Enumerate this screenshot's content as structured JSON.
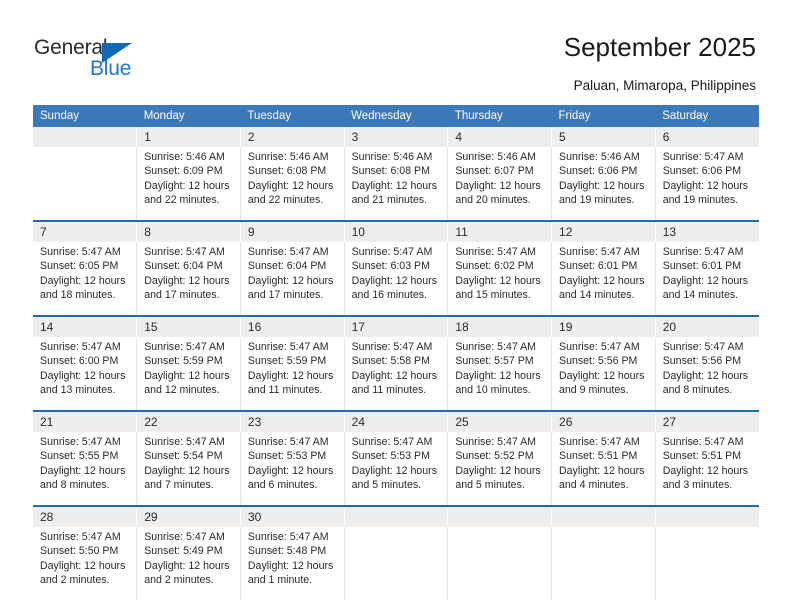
{
  "brand": {
    "name_top": "General",
    "name_bottom": "Blue",
    "color_primary": "#1269b0",
    "color_text": "#2b2b2b"
  },
  "header": {
    "title": "September 2025",
    "subtitle": "Paluan, Mimaropa, Philippines",
    "header_bg": "#3b79b8",
    "daynum_bg": "#eeeeee",
    "rule_color": "#1f6cb0"
  },
  "calendar": {
    "weekdays": [
      "Sunday",
      "Monday",
      "Tuesday",
      "Wednesday",
      "Thursday",
      "Friday",
      "Saturday"
    ],
    "weeks": [
      [
        {
          "day": "",
          "sunrise": "",
          "sunset": "",
          "daylight1": "",
          "daylight2": ""
        },
        {
          "day": "1",
          "sunrise": "Sunrise: 5:46 AM",
          "sunset": "Sunset: 6:09 PM",
          "daylight1": "Daylight: 12 hours",
          "daylight2": "and 22 minutes."
        },
        {
          "day": "2",
          "sunrise": "Sunrise: 5:46 AM",
          "sunset": "Sunset: 6:08 PM",
          "daylight1": "Daylight: 12 hours",
          "daylight2": "and 22 minutes."
        },
        {
          "day": "3",
          "sunrise": "Sunrise: 5:46 AM",
          "sunset": "Sunset: 6:08 PM",
          "daylight1": "Daylight: 12 hours",
          "daylight2": "and 21 minutes."
        },
        {
          "day": "4",
          "sunrise": "Sunrise: 5:46 AM",
          "sunset": "Sunset: 6:07 PM",
          "daylight1": "Daylight: 12 hours",
          "daylight2": "and 20 minutes."
        },
        {
          "day": "5",
          "sunrise": "Sunrise: 5:46 AM",
          "sunset": "Sunset: 6:06 PM",
          "daylight1": "Daylight: 12 hours",
          "daylight2": "and 19 minutes."
        },
        {
          "day": "6",
          "sunrise": "Sunrise: 5:47 AM",
          "sunset": "Sunset: 6:06 PM",
          "daylight1": "Daylight: 12 hours",
          "daylight2": "and 19 minutes."
        }
      ],
      [
        {
          "day": "7",
          "sunrise": "Sunrise: 5:47 AM",
          "sunset": "Sunset: 6:05 PM",
          "daylight1": "Daylight: 12 hours",
          "daylight2": "and 18 minutes."
        },
        {
          "day": "8",
          "sunrise": "Sunrise: 5:47 AM",
          "sunset": "Sunset: 6:04 PM",
          "daylight1": "Daylight: 12 hours",
          "daylight2": "and 17 minutes."
        },
        {
          "day": "9",
          "sunrise": "Sunrise: 5:47 AM",
          "sunset": "Sunset: 6:04 PM",
          "daylight1": "Daylight: 12 hours",
          "daylight2": "and 17 minutes."
        },
        {
          "day": "10",
          "sunrise": "Sunrise: 5:47 AM",
          "sunset": "Sunset: 6:03 PM",
          "daylight1": "Daylight: 12 hours",
          "daylight2": "and 16 minutes."
        },
        {
          "day": "11",
          "sunrise": "Sunrise: 5:47 AM",
          "sunset": "Sunset: 6:02 PM",
          "daylight1": "Daylight: 12 hours",
          "daylight2": "and 15 minutes."
        },
        {
          "day": "12",
          "sunrise": "Sunrise: 5:47 AM",
          "sunset": "Sunset: 6:01 PM",
          "daylight1": "Daylight: 12 hours",
          "daylight2": "and 14 minutes."
        },
        {
          "day": "13",
          "sunrise": "Sunrise: 5:47 AM",
          "sunset": "Sunset: 6:01 PM",
          "daylight1": "Daylight: 12 hours",
          "daylight2": "and 14 minutes."
        }
      ],
      [
        {
          "day": "14",
          "sunrise": "Sunrise: 5:47 AM",
          "sunset": "Sunset: 6:00 PM",
          "daylight1": "Daylight: 12 hours",
          "daylight2": "and 13 minutes."
        },
        {
          "day": "15",
          "sunrise": "Sunrise: 5:47 AM",
          "sunset": "Sunset: 5:59 PM",
          "daylight1": "Daylight: 12 hours",
          "daylight2": "and 12 minutes."
        },
        {
          "day": "16",
          "sunrise": "Sunrise: 5:47 AM",
          "sunset": "Sunset: 5:59 PM",
          "daylight1": "Daylight: 12 hours",
          "daylight2": "and 11 minutes."
        },
        {
          "day": "17",
          "sunrise": "Sunrise: 5:47 AM",
          "sunset": "Sunset: 5:58 PM",
          "daylight1": "Daylight: 12 hours",
          "daylight2": "and 11 minutes."
        },
        {
          "day": "18",
          "sunrise": "Sunrise: 5:47 AM",
          "sunset": "Sunset: 5:57 PM",
          "daylight1": "Daylight: 12 hours",
          "daylight2": "and 10 minutes."
        },
        {
          "day": "19",
          "sunrise": "Sunrise: 5:47 AM",
          "sunset": "Sunset: 5:56 PM",
          "daylight1": "Daylight: 12 hours",
          "daylight2": "and 9 minutes."
        },
        {
          "day": "20",
          "sunrise": "Sunrise: 5:47 AM",
          "sunset": "Sunset: 5:56 PM",
          "daylight1": "Daylight: 12 hours",
          "daylight2": "and 8 minutes."
        }
      ],
      [
        {
          "day": "21",
          "sunrise": "Sunrise: 5:47 AM",
          "sunset": "Sunset: 5:55 PM",
          "daylight1": "Daylight: 12 hours",
          "daylight2": "and 8 minutes."
        },
        {
          "day": "22",
          "sunrise": "Sunrise: 5:47 AM",
          "sunset": "Sunset: 5:54 PM",
          "daylight1": "Daylight: 12 hours",
          "daylight2": "and 7 minutes."
        },
        {
          "day": "23",
          "sunrise": "Sunrise: 5:47 AM",
          "sunset": "Sunset: 5:53 PM",
          "daylight1": "Daylight: 12 hours",
          "daylight2": "and 6 minutes."
        },
        {
          "day": "24",
          "sunrise": "Sunrise: 5:47 AM",
          "sunset": "Sunset: 5:53 PM",
          "daylight1": "Daylight: 12 hours",
          "daylight2": "and 5 minutes."
        },
        {
          "day": "25",
          "sunrise": "Sunrise: 5:47 AM",
          "sunset": "Sunset: 5:52 PM",
          "daylight1": "Daylight: 12 hours",
          "daylight2": "and 5 minutes."
        },
        {
          "day": "26",
          "sunrise": "Sunrise: 5:47 AM",
          "sunset": "Sunset: 5:51 PM",
          "daylight1": "Daylight: 12 hours",
          "daylight2": "and 4 minutes."
        },
        {
          "day": "27",
          "sunrise": "Sunrise: 5:47 AM",
          "sunset": "Sunset: 5:51 PM",
          "daylight1": "Daylight: 12 hours",
          "daylight2": "and 3 minutes."
        }
      ],
      [
        {
          "day": "28",
          "sunrise": "Sunrise: 5:47 AM",
          "sunset": "Sunset: 5:50 PM",
          "daylight1": "Daylight: 12 hours",
          "daylight2": "and 2 minutes."
        },
        {
          "day": "29",
          "sunrise": "Sunrise: 5:47 AM",
          "sunset": "Sunset: 5:49 PM",
          "daylight1": "Daylight: 12 hours",
          "daylight2": "and 2 minutes."
        },
        {
          "day": "30",
          "sunrise": "Sunrise: 5:47 AM",
          "sunset": "Sunset: 5:48 PM",
          "daylight1": "Daylight: 12 hours",
          "daylight2": "and 1 minute."
        },
        {
          "day": "",
          "sunrise": "",
          "sunset": "",
          "daylight1": "",
          "daylight2": ""
        },
        {
          "day": "",
          "sunrise": "",
          "sunset": "",
          "daylight1": "",
          "daylight2": ""
        },
        {
          "day": "",
          "sunrise": "",
          "sunset": "",
          "daylight1": "",
          "daylight2": ""
        },
        {
          "day": "",
          "sunrise": "",
          "sunset": "",
          "daylight1": "",
          "daylight2": ""
        }
      ]
    ]
  }
}
